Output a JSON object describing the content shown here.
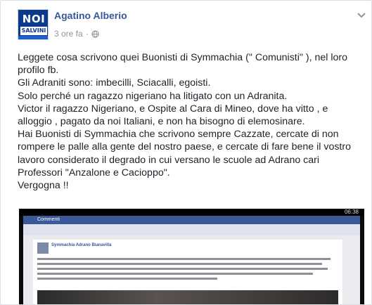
{
  "post": {
    "author": "Agatino Alberio",
    "time": "3 ore fa",
    "separator": "·",
    "audience_icon": "globe-icon",
    "menu_icon": "chevron-down-icon",
    "avatar": {
      "line1": "NOI",
      "line2": "SALVINI"
    },
    "lines": [
      "Leggete cosa scrivono quei Buonisti di Symmachia (\" Comunisti\" ), nel loro",
      "profilo fb.",
      "Gli Adraniti sono: imbecilli, Sciacalli, egoisti.",
      "Solo perché un ragazzo nigeriano ha litigato con un Adranita.",
      "Victor il ragazzo Nigeriano, e Ospite al Cara di Mineo, dove ha vitto , e",
      "alloggio , pagato da noi Italiani, e non ha bisogno di elemosinare.",
      "Hai Buonisti di Symmachia che scrivono sempre Cazzate, cercate di non",
      "rompere le palle alla gente del nostro paese, e cercate di fare bene il vostro",
      "lavoro considerato il degrado in cui versano le scuole ad Adrano cari",
      "Professori \"Anzalone e Cacioppo\".",
      "Vergogna !!"
    ]
  },
  "screenshot": {
    "status_time": "06:38",
    "app_title": "Commenti",
    "page_name": "Symmachia Adrano Bianavilla"
  }
}
